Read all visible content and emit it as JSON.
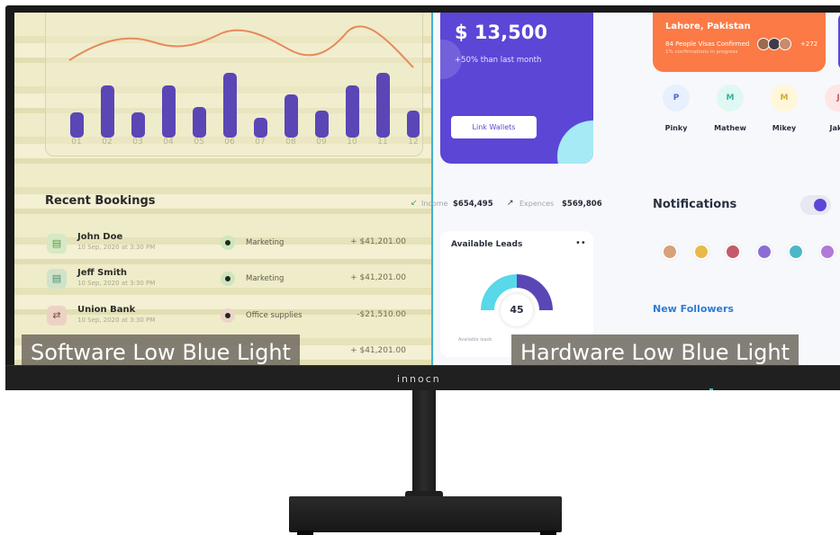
{
  "left_panel": {
    "chart": {
      "ticks": [
        "01",
        "02",
        "03",
        "04",
        "05",
        "06",
        "07",
        "08",
        "09",
        "10",
        "11",
        "12"
      ]
    },
    "recent_bookings_title": "Recent Bookings",
    "bookings": [
      {
        "name": "John Doe",
        "date": "10 Sep, 2020 at 3:30 PM",
        "category": "Marketing",
        "amount": "+ $41,201.00"
      },
      {
        "name": "Jeff Smith",
        "date": "10 Sep, 2020 at 3:30 PM",
        "category": "Marketing",
        "amount": "+ $41,201.00"
      },
      {
        "name": "Union Bank",
        "date": "10 Sep, 2020 at 3:30 PM",
        "category": "Office supplies",
        "amount": "-$21,510.00"
      },
      {
        "name": "",
        "date": "",
        "category": "",
        "amount": "+ $41,201.00"
      }
    ],
    "caption": "Software Low Blue Light"
  },
  "right_panel": {
    "wallet": {
      "amount": "$ 13,500",
      "change": "+50% than last month",
      "button": "Link Wallets"
    },
    "income": {
      "label": "Income",
      "value": "$654,495"
    },
    "expences": {
      "label": "Expences",
      "value": "$569,806"
    },
    "leads": {
      "title": "Available Leads",
      "more": "••",
      "center": "45",
      "legend": "Available leads"
    },
    "location": {
      "title": "Lahore, Pakistan",
      "subtitle": "84 People Visas Confirmed",
      "note": "1% confirmations in progress",
      "more": "+272"
    },
    "people": [
      {
        "initial": "P",
        "name": "Pinky"
      },
      {
        "initial": "M",
        "name": "Mathew"
      },
      {
        "initial": "M",
        "name": "Mikey"
      },
      {
        "initial": "J",
        "name": "Jake"
      }
    ],
    "notifications_title": "Notifications",
    "new_followers_title": "New Followers",
    "caption": "Hardware Low Blue Light"
  },
  "monitor": {
    "brand": "innocn"
  }
}
